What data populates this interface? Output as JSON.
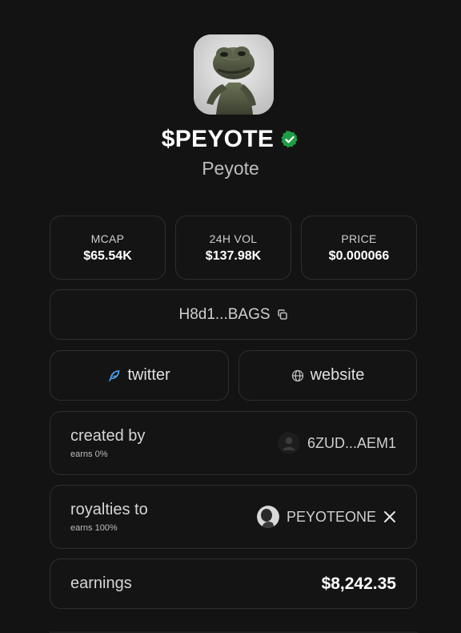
{
  "token": {
    "ticker": "$PEYOTE",
    "name": "Peyote",
    "avatar_icon": "frog-avatar-image",
    "verified_icon": "verified-check-icon",
    "verified_color": "#1f9d46"
  },
  "stats": [
    {
      "label": "MCAP",
      "value": "$65.54K"
    },
    {
      "label": "24H VOL",
      "value": "$137.98K"
    },
    {
      "label": "PRICE",
      "value": "$0.000066"
    }
  ],
  "contract": {
    "address": "H8d1...BAGS",
    "icon": "copy-icon"
  },
  "links": {
    "twitter_label": "twitter",
    "twitter_icon": "feather-icon",
    "website_label": "website",
    "website_icon": "globe-icon"
  },
  "created_by": {
    "title": "created by",
    "sub": "earns 0%",
    "address": "6ZUD...AEM1",
    "icon": "user-avatar-icon"
  },
  "royalties": {
    "title": "royalties to",
    "sub": "earns 100%",
    "handle": "PEYOTEONE",
    "icon": "x-logo-icon"
  },
  "earnings": {
    "title": "earnings",
    "value": "$8,242.35"
  },
  "colors": {
    "background": "#131313",
    "card_border": "#2f2f2f",
    "text_primary": "#ffffff",
    "text_secondary": "#bdbdbd",
    "twitter_accent": "#4aa8ff"
  }
}
